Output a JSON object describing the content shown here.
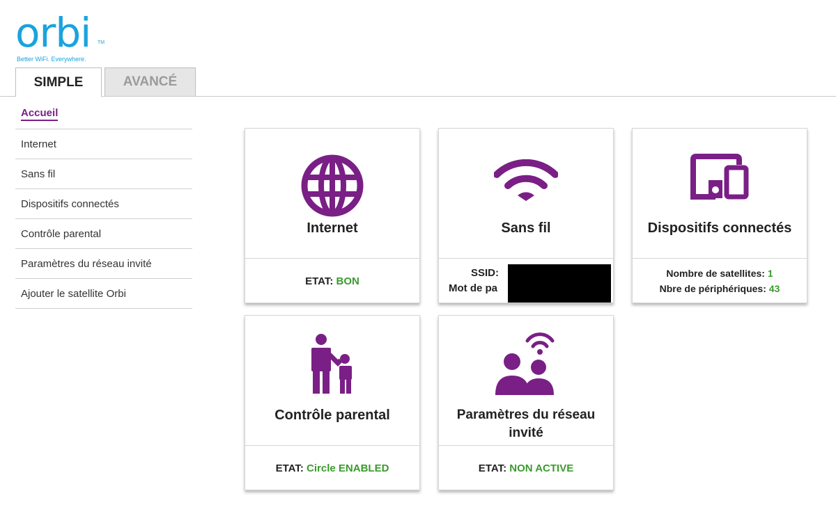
{
  "logo": {
    "word": "orbi",
    "tm": "TM",
    "tagline": "Better WiFi. Everywhere."
  },
  "tabs": [
    {
      "label": "SIMPLE",
      "active": true
    },
    {
      "label": "AVANCÉ",
      "active": false
    }
  ],
  "sidebar": {
    "items": [
      {
        "label": "Accueil",
        "active": true
      },
      {
        "label": "Internet"
      },
      {
        "label": "Sans fil"
      },
      {
        "label": "Dispositifs connectés"
      },
      {
        "label": "Contrôle parental"
      },
      {
        "label": "Paramètres du réseau invité"
      },
      {
        "label": "Ajouter le satellite Orbi"
      }
    ]
  },
  "cards": {
    "internet": {
      "title": "Internet",
      "status_label": "ETAT:",
      "status_value": "BON",
      "icon": "globe-icon"
    },
    "wireless": {
      "title": "Sans fil",
      "ssid_label": "SSID:",
      "password_label": "Mot de pa",
      "icon": "wifi-icon"
    },
    "devices": {
      "title": "Dispositifs connectés",
      "satellites_label": "Nombre de satellites:",
      "satellites_value": "1",
      "devices_label": "Nbre de périphériques:",
      "devices_value": "43",
      "icon": "devices-icon"
    },
    "parental": {
      "title": "Contrôle parental",
      "status_label": "ETAT:",
      "status_value": "Circle ENABLED",
      "icon": "parent-child-icon"
    },
    "guest": {
      "title_line1": "Paramètres du réseau",
      "title_line2": "invité",
      "status_label": "ETAT:",
      "status_value": "NON ACTIVE",
      "icon": "guest-network-icon"
    }
  },
  "colors": {
    "accent": "#7a1f86",
    "brand": "#1aa3de",
    "status_ok": "#3a9b2c"
  }
}
